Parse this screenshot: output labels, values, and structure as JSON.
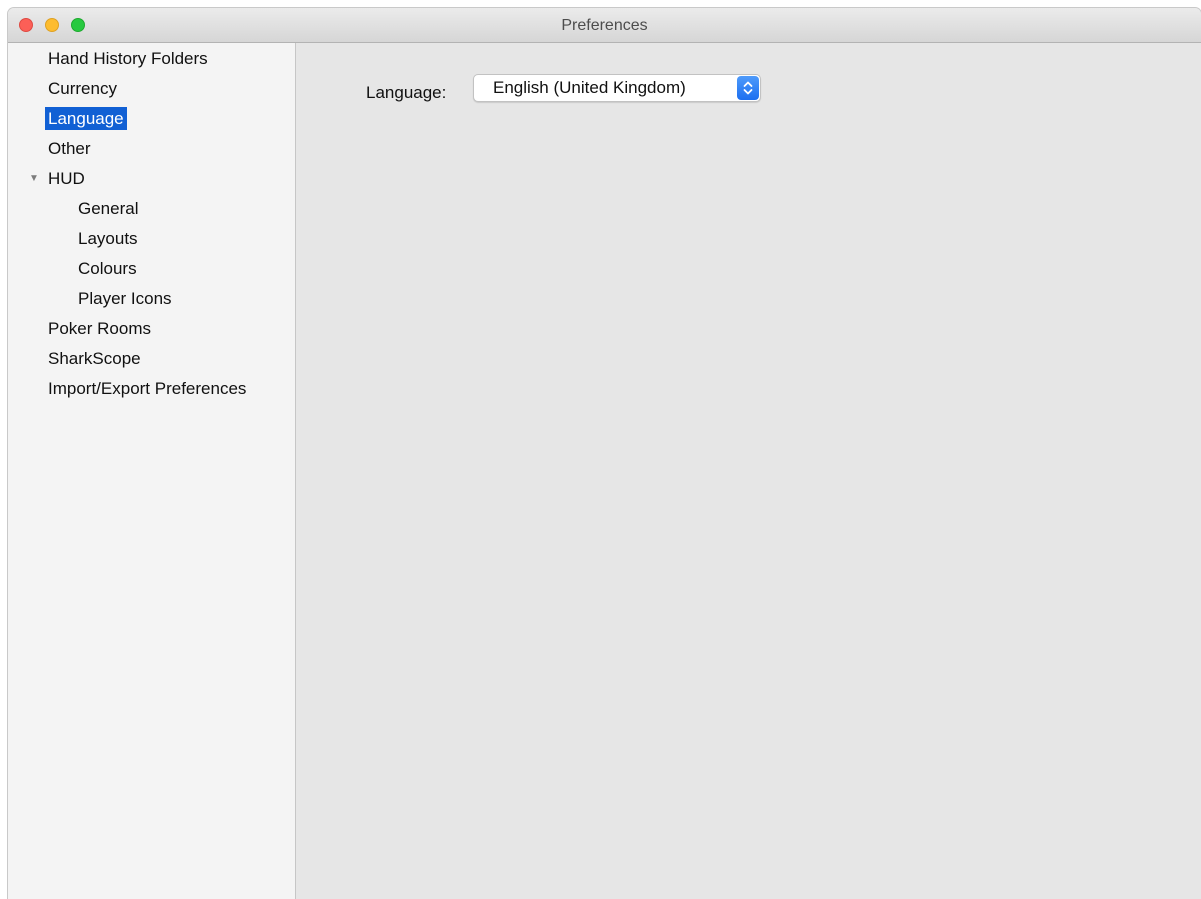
{
  "window": {
    "title": "Preferences"
  },
  "sidebar": {
    "items": [
      {
        "label": "Hand History Folders"
      },
      {
        "label": "Currency"
      },
      {
        "label": "Language",
        "selected": true
      },
      {
        "label": "Other"
      },
      {
        "label": "HUD",
        "expanded": true
      },
      {
        "label": "General"
      },
      {
        "label": "Layouts"
      },
      {
        "label": "Colours"
      },
      {
        "label": "Player Icons"
      },
      {
        "label": "Poker Rooms"
      },
      {
        "label": "SharkScope"
      },
      {
        "label": "Import/Export Preferences"
      }
    ]
  },
  "content": {
    "language_label": "Language:",
    "language_value": "English (United Kingdom)"
  },
  "colors": {
    "selection": "#1160d4",
    "popup_accent": "#2b7df5"
  },
  "icons": {
    "disclosure": "disclosure-triangle-down-icon",
    "popup": "up-down-chevron-icon"
  }
}
